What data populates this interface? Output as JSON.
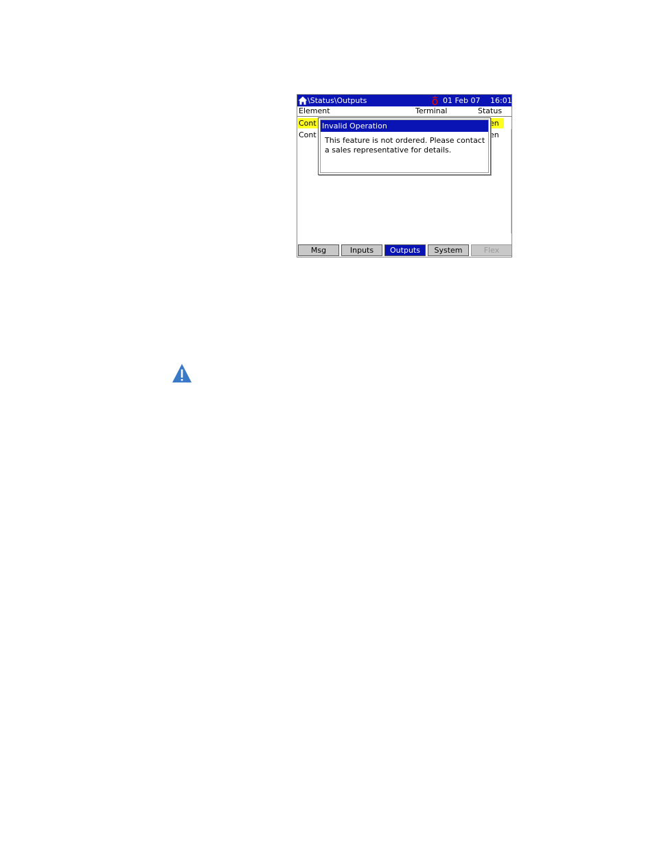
{
  "screen": {
    "path": "\\Status\\Outputs",
    "date": "01 Feb 07",
    "time": "16:01",
    "icons": {
      "home": "home-icon",
      "alarm": "alarm-bell-icon"
    },
    "columns": {
      "element": "Element",
      "terminal": "Terminal",
      "status": "Status"
    },
    "rows": [
      {
        "element": "Cont",
        "status": "en",
        "highlighted": true
      },
      {
        "element": "Cont",
        "status": "en",
        "highlighted": false
      }
    ],
    "tabs": [
      {
        "label": "Msg",
        "state": "normal"
      },
      {
        "label": "Inputs",
        "state": "normal"
      },
      {
        "label": "Outputs",
        "state": "active"
      },
      {
        "label": "System",
        "state": "normal"
      },
      {
        "label": "Flex",
        "state": "disabled"
      }
    ],
    "colors": {
      "title_bar": "#0a14b4",
      "highlight": "#ffff22",
      "alarm": "#e01010"
    }
  },
  "dialog": {
    "title": "Invalid Operation",
    "message": "This feature is not ordered.  Please contact a sales representative for details."
  },
  "page": {
    "caution_icon": "warning-triangle-icon",
    "caution_color": "#3a78c8"
  }
}
